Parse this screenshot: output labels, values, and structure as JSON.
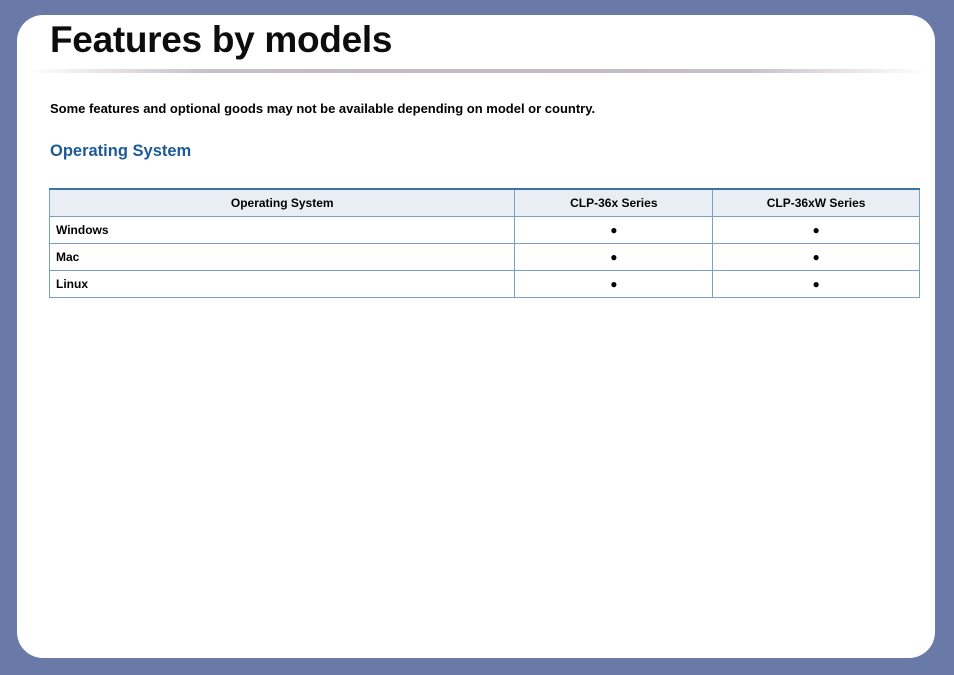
{
  "page": {
    "title": "Features by models",
    "note": "Some features and optional goods may not be available depending on model or country.",
    "section_heading": "Operating System"
  },
  "table": {
    "headers": [
      "Operating System",
      "CLP-36x Series",
      "CLP-36xW Series"
    ],
    "rows": [
      {
        "os": "Windows",
        "clp36x": "●",
        "clp36xw": "●"
      },
      {
        "os": "Mac",
        "clp36x": "●",
        "clp36xw": "●"
      },
      {
        "os": "Linux",
        "clp36x": "●",
        "clp36xw": "●"
      }
    ]
  },
  "colors": {
    "background": "#6a7aa8",
    "heading_blue": "#1d5b94",
    "table_border": "#7d9fc6",
    "header_fill": "#e9eef5"
  }
}
